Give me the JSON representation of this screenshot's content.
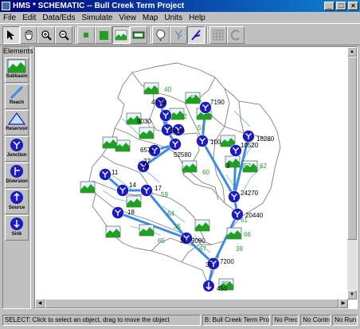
{
  "window": {
    "title": "HMS * SCHEMATIC -- Bull Creek Term Project"
  },
  "menu": [
    "File",
    "Edit",
    "Data/Eds",
    "Simulate",
    "View",
    "Map",
    "Units",
    "Help"
  ],
  "toolbar": {
    "mode_label": "basin"
  },
  "palette": {
    "title": "Elements",
    "items": [
      "Subbasin",
      "Reach",
      "Reservoir",
      "Junction",
      "Diversion",
      "Source",
      "Sink"
    ]
  },
  "map_labels": [
    "40",
    "4790",
    "41",
    "7190",
    "9030",
    "42",
    "46",
    "3440",
    "51",
    "100",
    "6570",
    "52580",
    "18280",
    "10520",
    "27",
    "29",
    "60",
    "3",
    "57",
    "62",
    "11",
    "14",
    "17",
    "59",
    "24270",
    "18",
    "64",
    "20440",
    "61",
    "35",
    "66",
    "65",
    "36",
    "9090",
    "38",
    "67",
    "37",
    "7200",
    "39",
    "450"
  ],
  "status": {
    "message": "SELECT: Click to select an object, drag to move the object",
    "project": "B: Bull Creek Term Project",
    "precip": "No Precip",
    "control": "No Control",
    "run": "No Run"
  },
  "colors": {
    "title_bar": "#000080",
    "junction": "#1c1cc0",
    "reach": "#3c8ce6",
    "boundary": "#808080"
  }
}
